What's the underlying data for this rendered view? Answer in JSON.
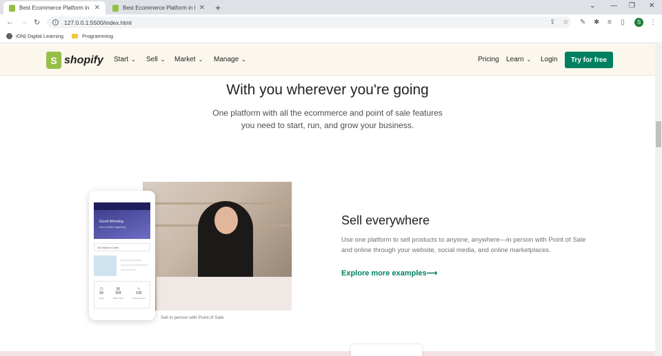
{
  "browser": {
    "tabs": [
      {
        "title": "Best Ecommerce Platform in India",
        "close": "✕"
      },
      {
        "title": "Best Ecommerce Platform in India",
        "close": "✕"
      }
    ],
    "new_tab": "+",
    "url": "127.0.0.1:5500/index.html",
    "profile_initial": "S",
    "bookmarks": [
      {
        "label": "iON| Digital Learning"
      },
      {
        "label": "Programming"
      }
    ]
  },
  "site": {
    "logo_text": "shopify",
    "logo_mark": "S",
    "nav_left": [
      {
        "label": "Start"
      },
      {
        "label": "Sell"
      },
      {
        "label": "Market"
      },
      {
        "label": "Manage"
      }
    ],
    "nav_right": {
      "pricing": "Pricing",
      "learn": "Learn",
      "login": "Login",
      "cta": "Try for free"
    }
  },
  "hero": {
    "title": "With you wherever you're going",
    "subtitle_line1": "One platform with all the ecommerce and point of sale features",
    "subtitle_line2": "you need to start, run, and grow your business."
  },
  "phone": {
    "greeting": "Good Morning",
    "greeting_sub": "Here's what's happening",
    "row_text": "340 visitors in SoHo",
    "stats": [
      {
        "value": "59",
        "label": "Sales"
      },
      {
        "value": "304",
        "label": "Total orders"
      },
      {
        "value": "230",
        "label": "Total sessions"
      }
    ]
  },
  "feature": {
    "caption": "Sell in person with Point of Sale",
    "title": "Sell everywhere",
    "body": "Use one platform to sell products to anyone, anywhere—in person with Point of Sale and online through your website, social media, and online marketplaces.",
    "link": "Explore more examples",
    "link_arrow": "⟶"
  },
  "colors": {
    "brand_green": "#008060",
    "shopify_bag": "#95bf47",
    "header_bg": "#fbf7ed"
  }
}
